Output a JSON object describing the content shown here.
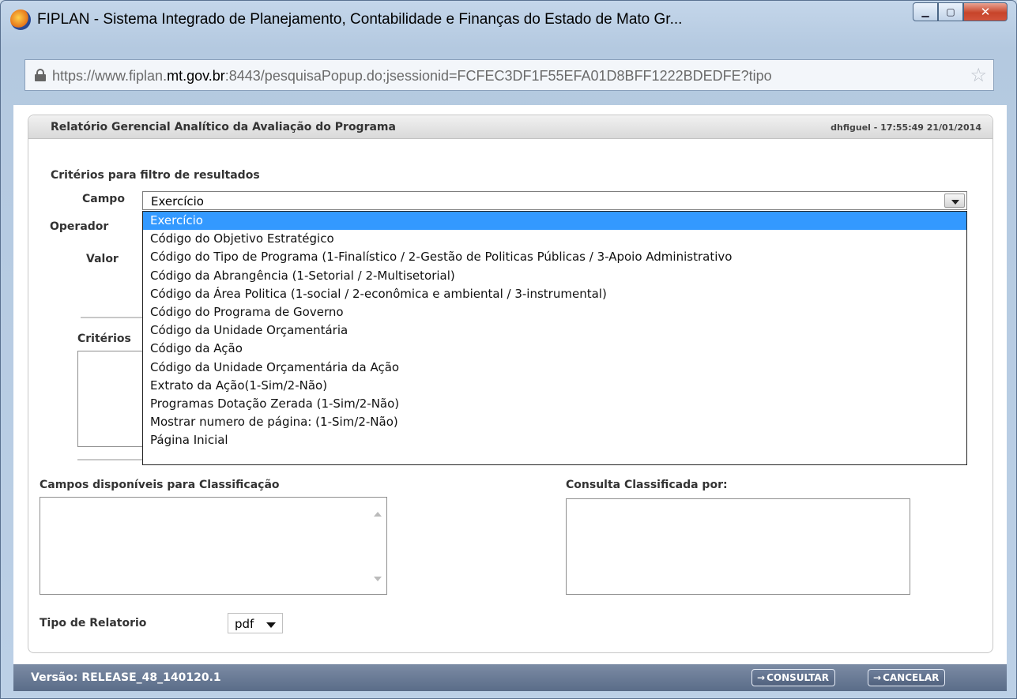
{
  "window": {
    "title": "FIPLAN - Sistema Integrado de Planejamento, Contabilidade e Finanças do Estado de Mato Gr...",
    "url_prefix": "https://www.fiplan.",
    "url_domain": "mt.gov.br",
    "url_suffix": ":8443/pesquisaPopup.do;jsessionid=FCFEC3DF1F55EFA01D8BFF1222BDEDFE?tipo"
  },
  "header": {
    "title": "Relatório Gerencial Analítico da Avaliação do Programa",
    "user_info": "dhfiguel - 17:55:49 21/01/2014"
  },
  "filter": {
    "section_label": "Critérios para filtro de resultados",
    "campo_label": "Campo",
    "operador_label": "Operador",
    "valor_label": "Valor",
    "criterios_label": "Critérios",
    "campo_value": "Exercício",
    "options": [
      "Exercício",
      "Código do Objetivo Estratégico",
      "Código do Tipo de Programa (1-Finalístico / 2-Gestão de Politicas Públicas / 3-Apoio Administrativo",
      "Código da Abrangência (1-Setorial / 2-Multisetorial)",
      "Código da Área Politica (1-social / 2-econômica e ambiental / 3-instrumental)",
      "Código do Programa de Governo",
      "Código da Unidade Orçamentária",
      "Código da Ação",
      "Código da Unidade Orçamentária da Ação",
      "Extrato da Ação(1-Sim/2-Não)",
      "Programas Dotação Zerada (1-Sim/2-Não)",
      "Mostrar numero de página: (1-Sim/2-Não)",
      "Página Inicial"
    ]
  },
  "classification": {
    "available_label": "Campos disponíveis para Classificação",
    "sorted_label": "Consulta Classificada por:"
  },
  "report": {
    "type_label": "Tipo de Relatorio",
    "type_value": "pdf"
  },
  "footer": {
    "version": "Versão: RELEASE_48_140120.1",
    "consultar": "CONSULTAR",
    "cancelar": "CANCELAR"
  }
}
